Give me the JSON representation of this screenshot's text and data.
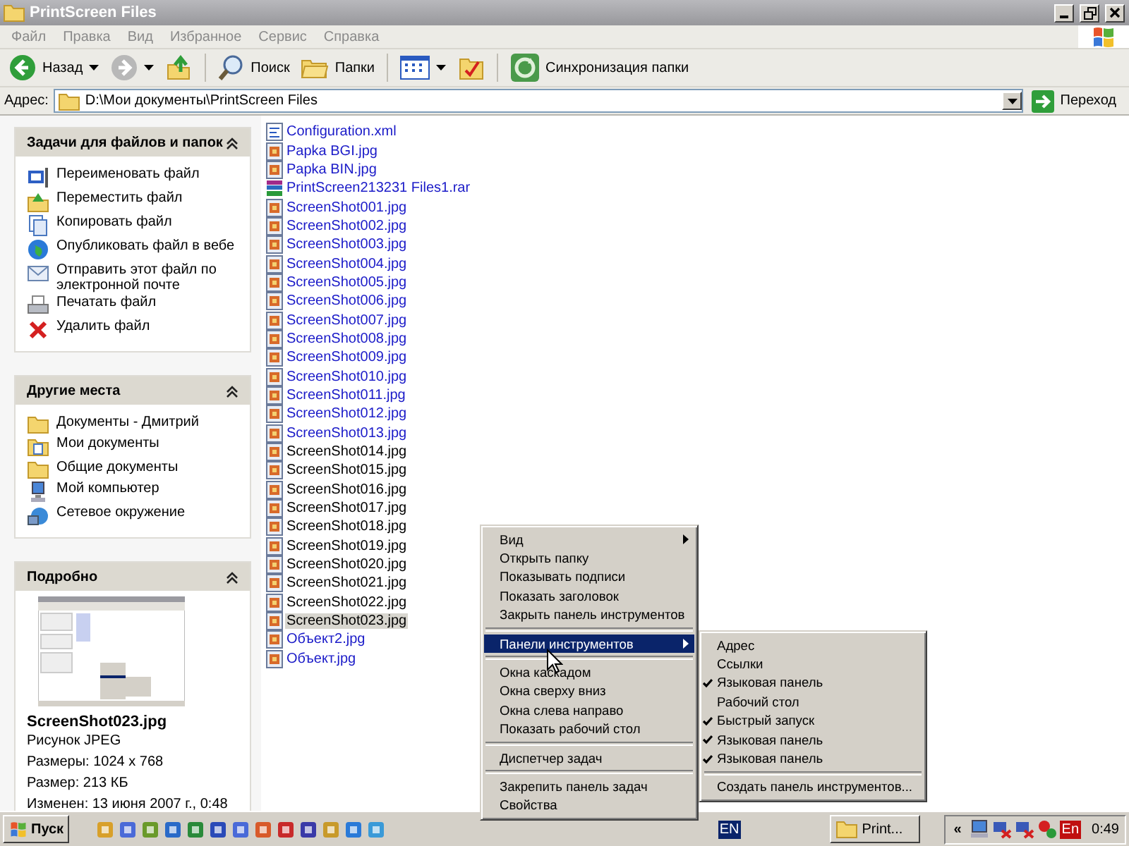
{
  "window": {
    "title": "PrintScreen Files"
  },
  "menu_bar": [
    "Файл",
    "Правка",
    "Вид",
    "Избранное",
    "Сервис",
    "Справка"
  ],
  "toolbar": [
    {
      "kind": "back",
      "label": "Назад"
    },
    {
      "kind": "forward"
    },
    {
      "kind": "up"
    },
    {
      "kind": "separator"
    },
    {
      "kind": "search",
      "label": "Поиск"
    },
    {
      "kind": "folders",
      "label": "Папки"
    },
    {
      "kind": "separator"
    },
    {
      "kind": "views"
    },
    {
      "kind": "checklist"
    },
    {
      "kind": "separator"
    },
    {
      "kind": "sync",
      "label": "Синхронизация папки"
    }
  ],
  "address": {
    "label": "Адрес:",
    "value": "D:\\Мои документы\\PrintScreen Files",
    "go": "Переход"
  },
  "task_panels": [
    {
      "title": "Задачи для файлов и папок",
      "items": [
        {
          "kind": "rename",
          "label": "Переименовать файл"
        },
        {
          "kind": "move",
          "label": "Переместить файл"
        },
        {
          "kind": "copy",
          "label": "Копировать файл"
        },
        {
          "kind": "publish",
          "label": "Опубликовать файл в вебе"
        },
        {
          "kind": "email",
          "label": "Отправить этот файл по электронной почте"
        },
        {
          "kind": "print",
          "label": "Печатать файл"
        },
        {
          "kind": "delete",
          "label": "Удалить файл"
        }
      ]
    },
    {
      "title": "Другие места",
      "items": [
        {
          "kind": "folder",
          "label": "Документы - Дмитрий"
        },
        {
          "kind": "mydocs",
          "label": "Мои документы"
        },
        {
          "kind": "folder",
          "label": "Общие документы"
        },
        {
          "kind": "computer",
          "label": "Мой компьютер"
        },
        {
          "kind": "network",
          "label": "Сетевое окружение"
        }
      ]
    }
  ],
  "details": {
    "title": "Подробно",
    "name": "ScreenShot023.jpg",
    "type": "Рисунок JPEG",
    "lines": [
      "Размеры: 1024 x 768",
      "Размер: 213 КБ",
      "Изменен: 13 июня 2007 г., 0:48"
    ]
  },
  "files": [
    {
      "name": "Configuration.xml",
      "kind": "xml",
      "color": "#1a1ac8",
      "selected": false
    },
    {
      "name": "Papka BGI.jpg",
      "kind": "jpg",
      "color": "#1a1ac8",
      "selected": false
    },
    {
      "name": "Papka BIN.jpg",
      "kind": "jpg",
      "color": "#1a1ac8",
      "selected": false
    },
    {
      "name": "PrintScreen213231 Files1.rar",
      "kind": "rar",
      "color": "#1a1ac8",
      "selected": false
    },
    {
      "name": "ScreenShot001.jpg",
      "kind": "jpg",
      "color": "#1a1ac8",
      "selected": false
    },
    {
      "name": "ScreenShot002.jpg",
      "kind": "jpg",
      "color": "#1a1ac8",
      "selected": false
    },
    {
      "name": "ScreenShot003.jpg",
      "kind": "jpg",
      "color": "#1a1ac8",
      "selected": false
    },
    {
      "name": "ScreenShot004.jpg",
      "kind": "jpg",
      "color": "#1a1ac8",
      "selected": false
    },
    {
      "name": "ScreenShot005.jpg",
      "kind": "jpg",
      "color": "#1a1ac8",
      "selected": false
    },
    {
      "name": "ScreenShot006.jpg",
      "kind": "jpg",
      "color": "#1a1ac8",
      "selected": false
    },
    {
      "name": "ScreenShot007.jpg",
      "kind": "jpg",
      "color": "#1a1ac8",
      "selected": false
    },
    {
      "name": "ScreenShot008.jpg",
      "kind": "jpg",
      "color": "#1a1ac8",
      "selected": false
    },
    {
      "name": "ScreenShot009.jpg",
      "kind": "jpg",
      "color": "#1a1ac8",
      "selected": false
    },
    {
      "name": "ScreenShot010.jpg",
      "kind": "jpg",
      "color": "#1a1ac8",
      "selected": false
    },
    {
      "name": "ScreenShot011.jpg",
      "kind": "jpg",
      "color": "#1a1ac8",
      "selected": false
    },
    {
      "name": "ScreenShot012.jpg",
      "kind": "jpg",
      "color": "#1a1ac8",
      "selected": false
    },
    {
      "name": "ScreenShot013.jpg",
      "kind": "jpg",
      "color": "#1a1ac8",
      "selected": false
    },
    {
      "name": "ScreenShot014.jpg",
      "kind": "jpg",
      "color": "#000000",
      "selected": false
    },
    {
      "name": "ScreenShot015.jpg",
      "kind": "jpg",
      "color": "#000000",
      "selected": false
    },
    {
      "name": "ScreenShot016.jpg",
      "kind": "jpg",
      "color": "#000000",
      "selected": false
    },
    {
      "name": "ScreenShot017.jpg",
      "kind": "jpg",
      "color": "#000000",
      "selected": false
    },
    {
      "name": "ScreenShot018.jpg",
      "kind": "jpg",
      "color": "#000000",
      "selected": false
    },
    {
      "name": "ScreenShot019.jpg",
      "kind": "jpg",
      "color": "#000000",
      "selected": false
    },
    {
      "name": "ScreenShot020.jpg",
      "kind": "jpg",
      "color": "#000000",
      "selected": false
    },
    {
      "name": "ScreenShot021.jpg",
      "kind": "jpg",
      "color": "#000000",
      "selected": false
    },
    {
      "name": "ScreenShot022.jpg",
      "kind": "jpg",
      "color": "#000000",
      "selected": false
    },
    {
      "name": "ScreenShot023.jpg",
      "kind": "jpg",
      "color": "#000000",
      "selected": true
    },
    {
      "name": "Объект2.jpg",
      "kind": "jpg",
      "color": "#1a1ac8",
      "selected": false
    },
    {
      "name": "Объект.jpg",
      "kind": "jpg",
      "color": "#1a1ac8",
      "selected": false
    }
  ],
  "context_menu": {
    "items": [
      {
        "kind": "item",
        "label": "Вид",
        "submenu": true,
        "selected": false
      },
      {
        "kind": "item",
        "label": "Открыть папку",
        "submenu": false,
        "selected": false
      },
      {
        "kind": "item",
        "label": "Показывать подписи",
        "submenu": false,
        "selected": false
      },
      {
        "kind": "item",
        "label": "Показать заголовок",
        "submenu": false,
        "selected": false
      },
      {
        "kind": "item",
        "label": "Закрыть панель инструментов",
        "submenu": false,
        "selected": false
      },
      {
        "kind": "separator"
      },
      {
        "kind": "item",
        "label": "Панели инструментов",
        "submenu": true,
        "selected": true
      },
      {
        "kind": "separator"
      },
      {
        "kind": "item",
        "label": "Окна каскадом",
        "submenu": false,
        "selected": false
      },
      {
        "kind": "item",
        "label": "Окна сверху вниз",
        "submenu": false,
        "selected": false
      },
      {
        "kind": "item",
        "label": "Окна слева направо",
        "submenu": false,
        "selected": false
      },
      {
        "kind": "item",
        "label": "Показать рабочий стол",
        "submenu": false,
        "selected": false
      },
      {
        "kind": "separator"
      },
      {
        "kind": "item",
        "label": "Диспетчер задач",
        "submenu": false,
        "selected": false
      },
      {
        "kind": "separator"
      },
      {
        "kind": "item",
        "label": "Закрепить панель задач",
        "submenu": false,
        "selected": false
      },
      {
        "kind": "item",
        "label": "Свойства",
        "submenu": false,
        "selected": false
      }
    ]
  },
  "submenu": {
    "items": [
      {
        "kind": "item",
        "label": "Адрес",
        "checked": false
      },
      {
        "kind": "item",
        "label": "Ссылки",
        "checked": false
      },
      {
        "kind": "item",
        "label": "Языковая панель",
        "checked": true
      },
      {
        "kind": "item",
        "label": "Рабочий стол",
        "checked": false
      },
      {
        "kind": "item",
        "label": "Быстрый запуск",
        "checked": true
      },
      {
        "kind": "item",
        "label": "Языковая панель",
        "checked": true
      },
      {
        "kind": "item",
        "label": "Языковая панель",
        "checked": true
      },
      {
        "kind": "separator"
      },
      {
        "kind": "item",
        "label": "Создать панель инструментов...",
        "checked": false
      }
    ]
  },
  "taskbar": {
    "start": "Пуск",
    "language": "EN",
    "tasks": [
      {
        "label": "Print...",
        "selected": false
      }
    ],
    "tray_expand": "«",
    "tray_language": "En",
    "clock": "0:49"
  }
}
